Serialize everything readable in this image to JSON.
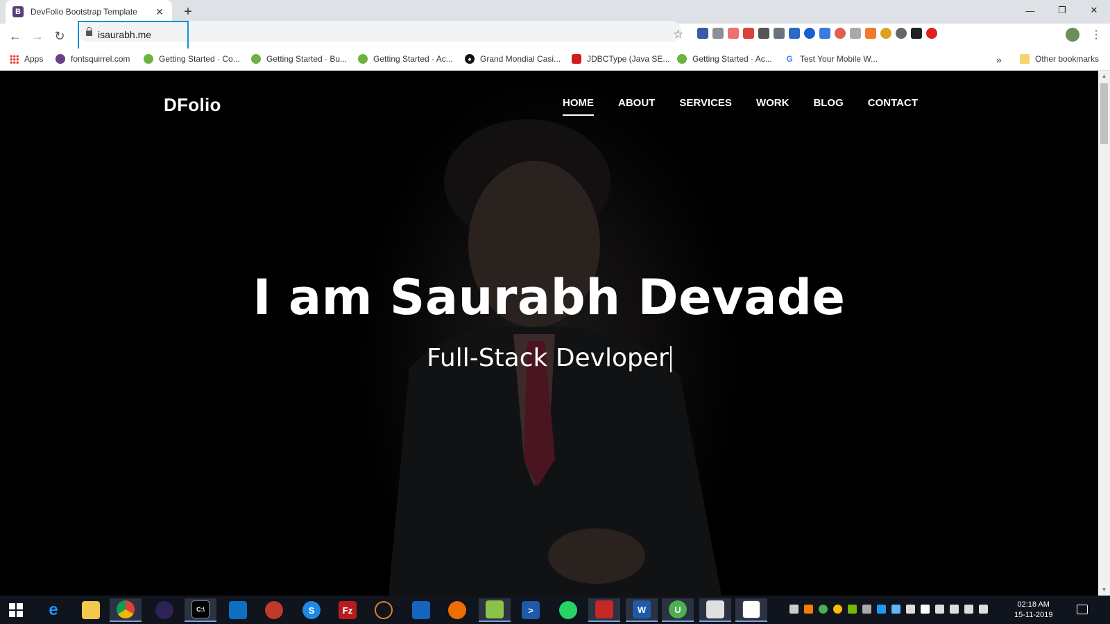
{
  "browser": {
    "tab_title": "DevFolio Bootstrap Template",
    "tab_favicon": "B",
    "url": "isaurabh.me",
    "bookmarks": [
      {
        "label": "Apps",
        "icon": "apps-grid-icon"
      },
      {
        "label": "fontsquirrel.com",
        "icon": "squirrel-icon"
      },
      {
        "label": "Getting Started · Co...",
        "icon": "spring-icon"
      },
      {
        "label": "Getting Started · Bu...",
        "icon": "spring-icon"
      },
      {
        "label": "Getting Started · Ac...",
        "icon": "spring-icon"
      },
      {
        "label": "Grand Mondial Casi...",
        "icon": "spade-icon"
      },
      {
        "label": "JDBCType (Java SE...",
        "icon": "java-icon"
      },
      {
        "label": "Getting Started · Ac...",
        "icon": "spring-icon"
      },
      {
        "label": "Test Your Mobile W...",
        "icon": "google-icon"
      }
    ],
    "bookmarks_overflow": "»",
    "other_bookmarks": "Other bookmarks"
  },
  "site": {
    "brand": "DFolio",
    "nav": [
      "HOME",
      "ABOUT",
      "SERVICES",
      "WORK",
      "BLOG",
      "CONTACT"
    ],
    "active_nav": "HOME",
    "hero_title": "I am Saurabh Devade",
    "hero_subtitle": "Full-Stack Devloper"
  },
  "taskbar": {
    "time": "02:18 AM",
    "date": "15-11-2019"
  },
  "colors": {
    "accent": "#1a8fd4",
    "page_bg": "#000000",
    "taskbar_bg": "#10141c"
  }
}
